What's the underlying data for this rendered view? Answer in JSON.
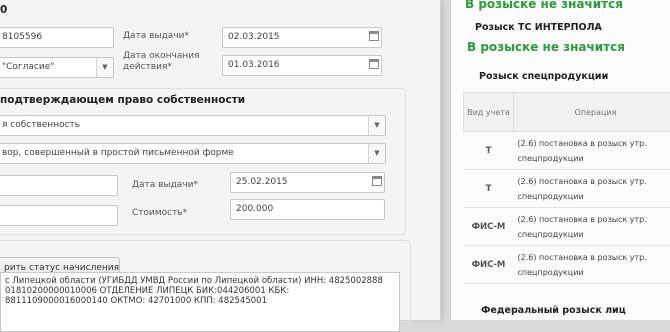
{
  "left_form": {
    "top_value": "0",
    "field_a_value": "8105596",
    "date_issue_label": "Дата выдачи*",
    "date_issue_value": "02.03.2015",
    "select_a_value": "\"Согласие\"",
    "date_end_label": "Дата окончания действия*",
    "date_end_value": "01.03.2016",
    "ownership_title": "подтверждающем право собственности",
    "ownership_type_value": "я собственность",
    "doc_type_value": "вор, совершенный в простой письменной форме",
    "date_issue2_label": "Дата выдачи*",
    "date_issue2_value": "25.02.2015",
    "cost_label": "Стоимость*",
    "cost_value": "200.000",
    "status_button": "рить статус начисления",
    "payment_text_line1": "с Липецкой области (УГИБДД УМВД России по Липецкой области) ИНН: 4825002888",
    "payment_text_line2": "01810200000010006 ОТДЕЛЕНИЕ ЛИПЕЦК БИК:044206001 КБК:",
    "payment_text_line3": "8811109000016000140 ОКТМО: 42701000 КПП: 482545001"
  },
  "right_panel": {
    "status1": "В розыске не значится",
    "interpol_title": "Розыск ТС ИНТЕРПОЛА",
    "status2": "В розыске не значится",
    "special_title": "Розыск спецпродукции",
    "table": {
      "headers": [
        "Вид учета",
        "Операция"
      ],
      "rows": [
        {
          "code": "Т",
          "op_line1": "(2.6) постановка в розыск утр.",
          "op_line2": "спецпродукции"
        },
        {
          "code": "Т",
          "op_line1": "(2.6) постановка в розыск утр.",
          "op_line2": "спецпродукции"
        },
        {
          "code": "ФИС-М",
          "op_line1": "(2.6) постановка в розыск утр.",
          "op_line2": "спецпродукции"
        },
        {
          "code": "ФИС-М",
          "op_line1": "(2.6) постановка в розыск утр.",
          "op_line2": "спецпродукции"
        }
      ]
    },
    "federal_title": "Федеральный розыск лиц"
  }
}
